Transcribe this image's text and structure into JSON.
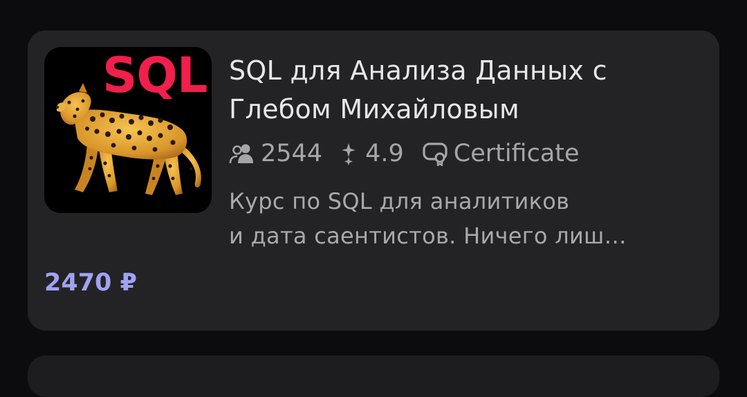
{
  "course": {
    "cover": {
      "text": "SQL",
      "image": "leopard",
      "text_color": "#f01f4b",
      "background": "#000000"
    },
    "title": "SQL для Анализа Данных с Глебом Михайловым",
    "students_count": "2544",
    "rating": "4.9",
    "certificate_label": "Certificate",
    "description_line1": "Курс по SQL для аналитиков",
    "description_line2": "и дата саентистов. Ничего лиш…",
    "price": "2470 ₽"
  },
  "icons": {
    "students": "people-icon",
    "rating": "sparkle-star-icon",
    "certificate": "certificate-icon"
  },
  "colors": {
    "page_background": "#0c0c0e",
    "card_background": "#232325",
    "title": "#e7e7e9",
    "secondary_text": "#a6a6a9",
    "price": "#9fa3f2",
    "accent_red": "#f01f4b"
  }
}
